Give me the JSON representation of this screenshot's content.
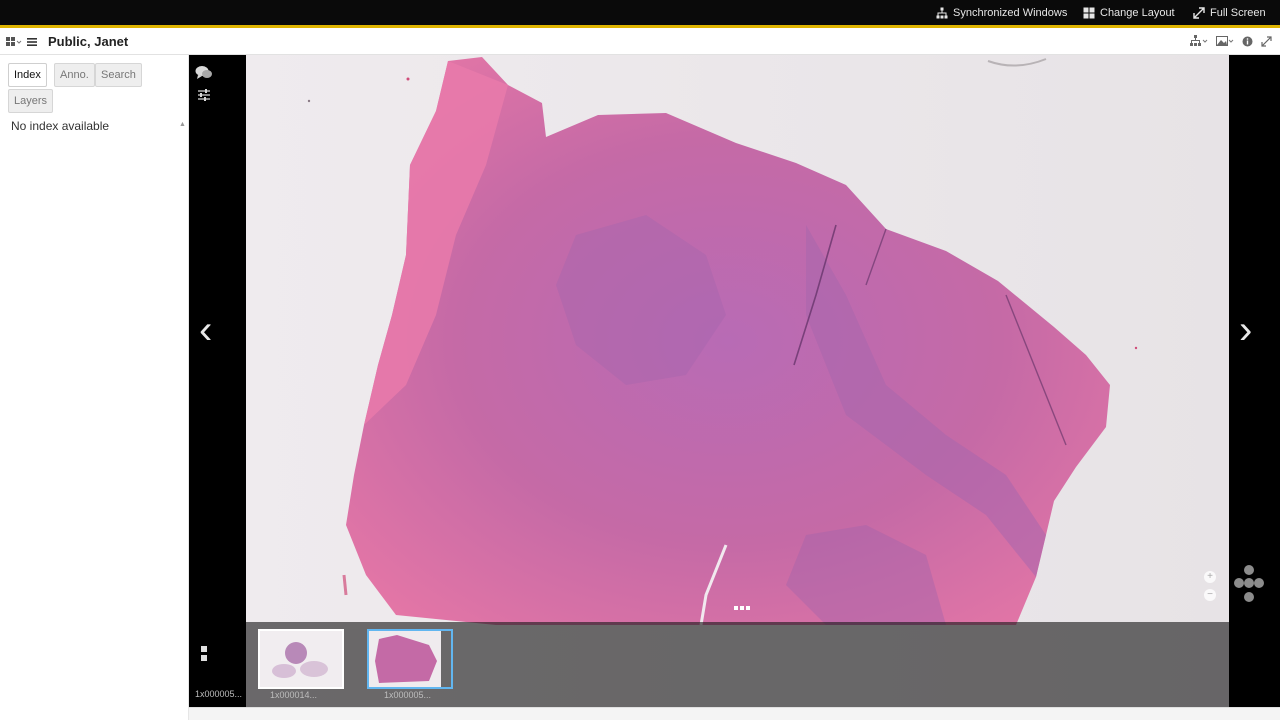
{
  "topbar": {
    "synchronized_windows": "Synchronized Windows",
    "change_layout": "Change Layout",
    "full_screen": "Full Screen",
    "accent_color": "#dfb400"
  },
  "header": {
    "patient_name": "Public, Janet",
    "icons": [
      "grid-icon",
      "hamburger-menu-icon",
      "hierarchy-icon",
      "image-icon",
      "info-icon",
      "expand-icon"
    ]
  },
  "sidebar": {
    "tabs": [
      {
        "label": "Index",
        "active": true
      },
      {
        "label": "Anno.",
        "active": false
      },
      {
        "label": "Search",
        "active": false
      },
      {
        "label": "Layers",
        "active": false
      }
    ],
    "empty_message": "No index available"
  },
  "viewer": {
    "toolbar_icons": [
      "chat-icon",
      "sliders-icon",
      "stack-icon"
    ],
    "left_label": "1x000005...",
    "thumbnails": [
      {
        "label": "1x000014...",
        "selected": false
      },
      {
        "label": "1x000005...",
        "selected": true
      }
    ],
    "selected_color": "#62b6f0"
  }
}
